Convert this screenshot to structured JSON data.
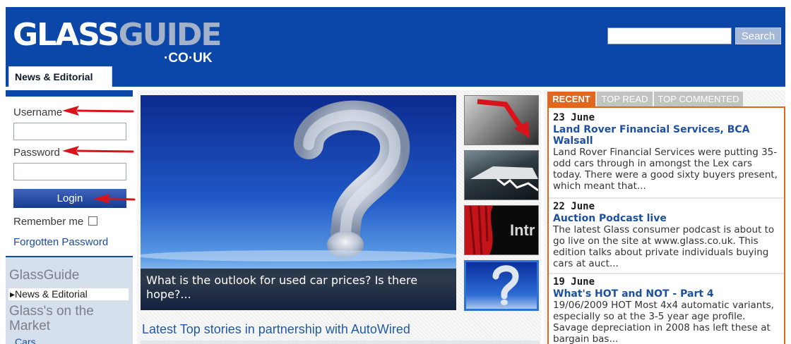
{
  "header": {
    "logo_glass": "GLASS",
    "logo_guide": "GUIDE",
    "logo_domain": "·CO·UK",
    "search_placeholder": "",
    "search_button": "Search",
    "tab_label": "News & Editorial"
  },
  "login": {
    "username_label": "Username",
    "password_label": "Password",
    "login_button": "Login",
    "remember_label": "Remember me",
    "forgot_link": "Forgotten Password"
  },
  "left_nav": {
    "title": "GlassGuide",
    "active_item": "▸News & Editorial",
    "section_title": "Glass's on the Market",
    "cars_link": "Cars"
  },
  "feature": {
    "caption": "What is the outlook for used car prices? Is there hope?...",
    "thumb_text": "Intr"
  },
  "top_stories": {
    "heading": "Latest Top stories in partnership with AutoWired"
  },
  "sidebar": {
    "tabs": [
      "RECENT",
      "TOP READ",
      "TOP COMMENTED"
    ],
    "stories": [
      {
        "date": "23 June",
        "title": "Land Rover Financial Services, BCA Walsall",
        "summary": "Land Rover Financial Services were putting 35-odd cars through in amongst the Lex cars today. There were a good sixty buyers present, which meant that..."
      },
      {
        "date": "22 June",
        "title": "Auction Podcast live",
        "summary": "The latest Glass consumer podcast is about to go live on the site at www.glass.co.uk. This edition talks about private individuals buying cars at auct..."
      },
      {
        "date": "19 June",
        "title": "What's HOT and NOT - Part 4",
        "summary": "19/06/2009 HOT Most 4x4 automatic variants, especially so at the 3-5 year age profile. Savage depreciation in 2008 has left these at bargain bas..."
      }
    ]
  },
  "colors": {
    "brand_blue": "#0b47a8",
    "accent_orange": "#e2661e",
    "annotation_arrow": "#d9131a"
  }
}
